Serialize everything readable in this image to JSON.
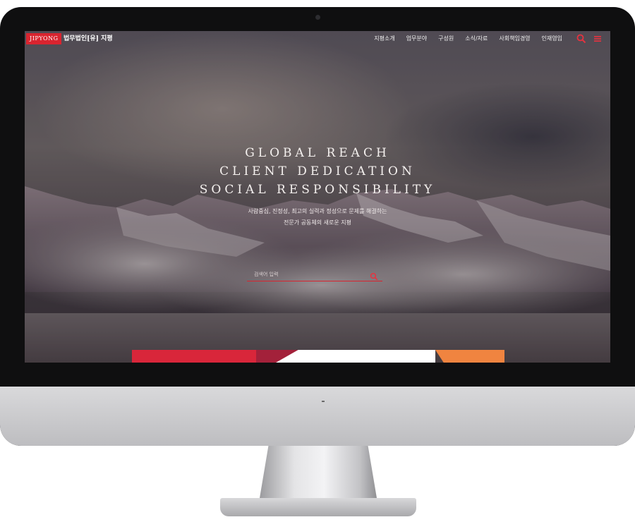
{
  "header": {
    "logo_badge": "JIPYONG",
    "logo_text": "법무법인[유] 지평",
    "menu": [
      {
        "label": "지평소개"
      },
      {
        "label": "업무분야"
      },
      {
        "label": "구성원"
      },
      {
        "label": "소식/자료"
      },
      {
        "label": "사회책임경영"
      },
      {
        "label": "인재영입"
      }
    ],
    "icons": [
      "search-icon",
      "hamburger-menu-icon"
    ]
  },
  "hero": {
    "headline": [
      "GLOBAL REACH",
      "CLIENT DEDICATION",
      "SOCIAL RESPONSIBILITY"
    ],
    "subtitle": [
      "사람중심, 진정성, 최고의 실력과 정성으로 문제를 해결하는",
      "전문가 공동체의 새로운 지평"
    ]
  },
  "search": {
    "placeholder": "검색어 입력"
  },
  "colors": {
    "accent": "#d9242f",
    "tab_red": "#d9263a",
    "tab_crimson": "#a3213a",
    "tab_white": "#ffffff",
    "tab_orange": "#f08440"
  }
}
